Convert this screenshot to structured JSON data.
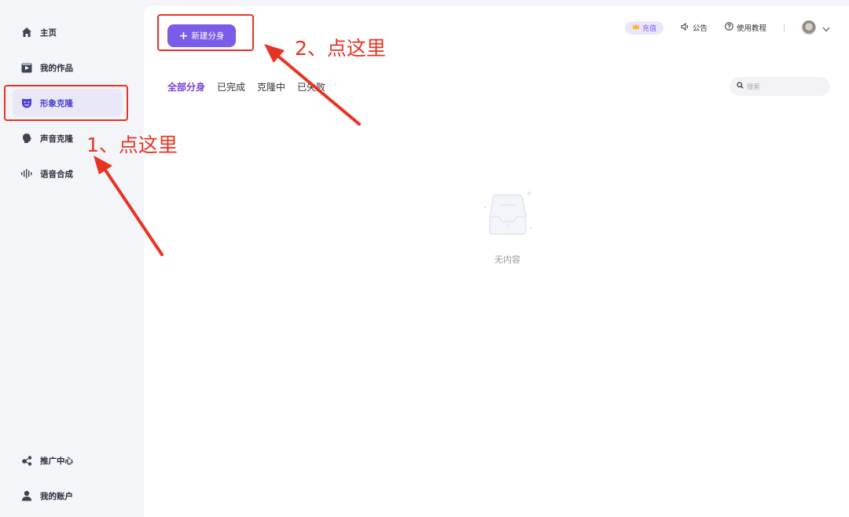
{
  "sidebar": {
    "items": [
      {
        "label": "主页",
        "icon": "home-icon"
      },
      {
        "label": "我的作品",
        "icon": "film-icon"
      },
      {
        "label": "形象克隆",
        "icon": "mask-icon",
        "active": true
      },
      {
        "label": "声音克隆",
        "icon": "speaking-head-icon"
      },
      {
        "label": "语音合成",
        "icon": "waveform-icon"
      }
    ],
    "bottom_items": [
      {
        "label": "推广中心",
        "icon": "share-icon"
      },
      {
        "label": "我的账户",
        "icon": "user-icon"
      }
    ]
  },
  "toolbar": {
    "new_button_label": "新建分身"
  },
  "topbar": {
    "recharge_label": "充值",
    "announcement_label": "公告",
    "tutorial_label": "使用教程"
  },
  "tabs": [
    "全部分身",
    "已完成",
    "克隆中",
    "已失败"
  ],
  "search": {
    "placeholder": "搜索"
  },
  "empty_state": {
    "text": "无内容"
  },
  "annotations": {
    "step1": "1、点这里",
    "step2": "2、点这里"
  },
  "colors": {
    "accent": "#7b5ce8",
    "annotation": "#e83323",
    "active_nav_bg": "#e8e8f6"
  }
}
